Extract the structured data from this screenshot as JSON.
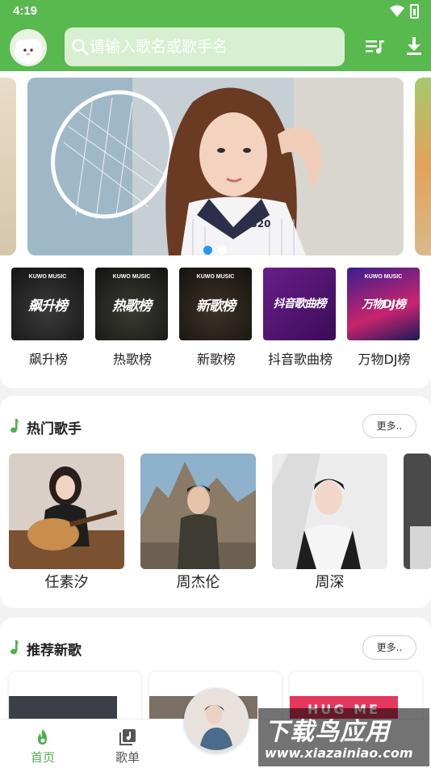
{
  "status_bar": {
    "time": "4:19"
  },
  "search": {
    "placeholder": "请输入歌名或歌手名"
  },
  "charts": [
    {
      "label": "飙升榜",
      "cover_text": "飙升榜",
      "brand": "KUWO MUSIC"
    },
    {
      "label": "热歌榜",
      "cover_text": "热歌榜",
      "brand": "KUWO MUSIC"
    },
    {
      "label": "新歌榜",
      "cover_text": "新歌榜",
      "brand": "KUWO MUSIC"
    },
    {
      "label": "抖音歌曲榜",
      "cover_text": "抖音歌曲榜",
      "brand": ""
    },
    {
      "label": "万物DJ榜",
      "cover_text": "万物DJ榜",
      "brand": "KUWO MUSIC"
    }
  ],
  "banner": {
    "dots": 2,
    "active_dot": 0,
    "shirt_text": "SS20"
  },
  "hot_singers": {
    "title": "热门歌手",
    "more_label": "更多..",
    "items": [
      {
        "name": "任素汐"
      },
      {
        "name": "周杰伦"
      },
      {
        "name": "周深"
      }
    ]
  },
  "new_songs": {
    "title": "推荐新歌",
    "more_label": "更多..",
    "cover_texts": [
      "",
      "",
      "HUG ME"
    ]
  },
  "nav": {
    "home_label": "首页",
    "playlist_label": "歌单"
  },
  "watermark": {
    "main": "下载鸟应用",
    "url": "www.xiazainiao.com"
  },
  "colors": {
    "brand_green": "#58b94f",
    "nav_active": "#4caf50",
    "nav_inactive": "#555555"
  }
}
